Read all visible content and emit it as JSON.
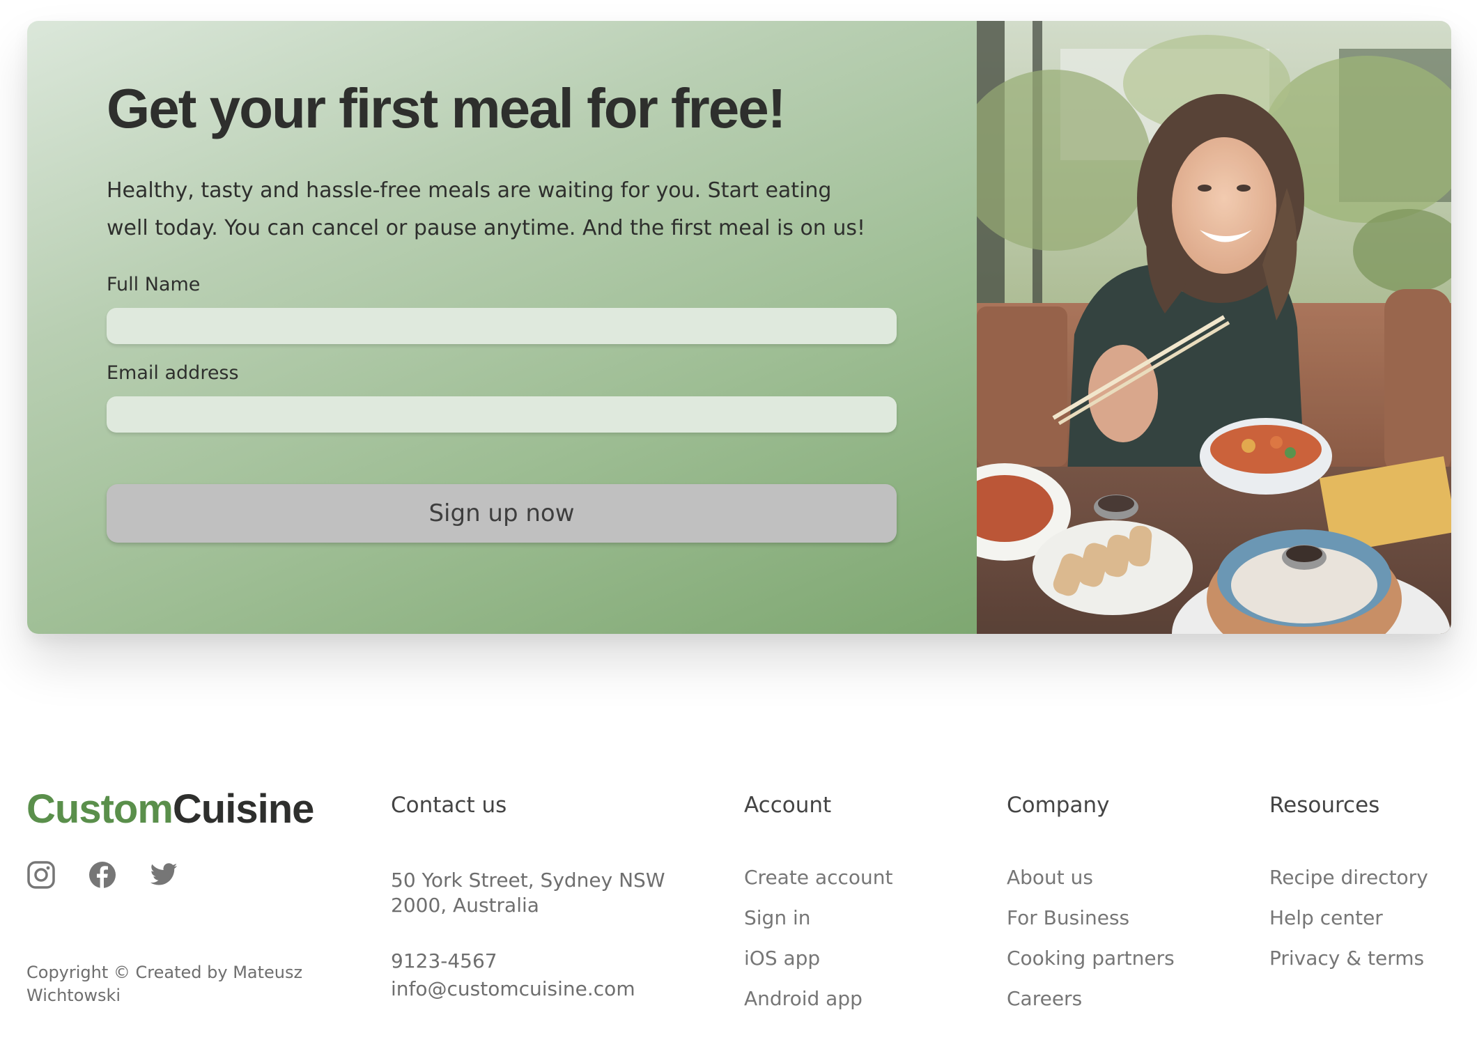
{
  "cta": {
    "title": "Get your first meal for free!",
    "description": "Healthy, tasty and hassle-free meals are waiting for you. Start eating well today. You can cancel or pause anytime. And the first meal is on us!",
    "full_name_label": "Full Name",
    "full_name_value": "",
    "email_label": "Email address",
    "email_value": "",
    "button_label": "Sign up now",
    "photo_icon": "woman-eating-dumplings-photo"
  },
  "footer": {
    "logo_part_a": "Custom",
    "logo_part_b": "Cuisine",
    "social": [
      {
        "icon": "instagram-icon"
      },
      {
        "icon": "facebook-icon"
      },
      {
        "icon": "twitter-icon"
      }
    ],
    "copyright": "Copyright © Created by Mateusz Wichtowski",
    "contact": {
      "heading": "Contact us",
      "address_line1": "50 York Street, Sydney NSW",
      "address_line2": "2000, Australia",
      "phone": "9123-4567",
      "email": "info@customcuisine.com"
    },
    "account": {
      "heading": "Account",
      "links": [
        "Create account",
        "Sign in",
        "iOS app",
        "Android app"
      ]
    },
    "company": {
      "heading": "Company",
      "links": [
        "About us",
        "For Business",
        "Cooking partners",
        "Careers"
      ]
    },
    "resources": {
      "heading": "Resources",
      "links": [
        "Recipe directory",
        "Help center",
        "Privacy & terms"
      ]
    }
  },
  "colors": {
    "brand_green": "#5a8f4b",
    "text_dark": "#2e2f2d",
    "button_gray": "#c0c0c0",
    "input_bg": "#dfe9dd"
  }
}
